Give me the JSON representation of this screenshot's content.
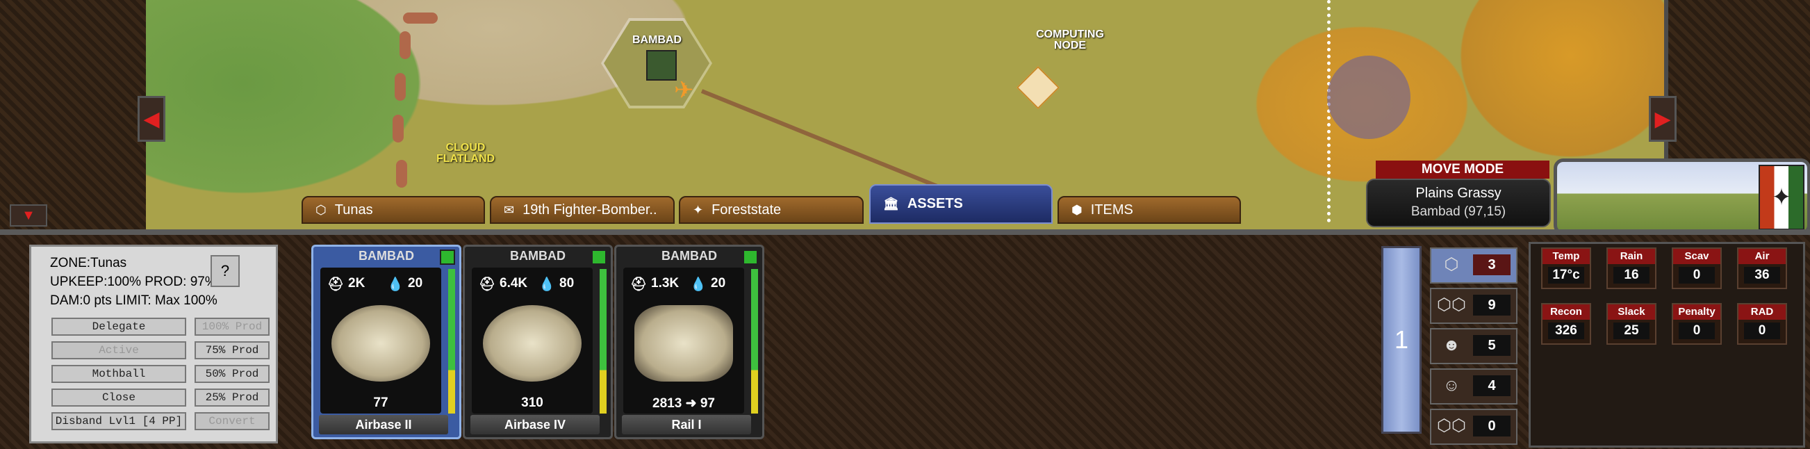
{
  "map": {
    "labels": {
      "bambad": "BAMBAD",
      "computing_node": "COMPUTING NODE",
      "cloud_flatland": "CLOUD FLATLAND"
    }
  },
  "tabs": [
    {
      "label": "Tunas",
      "icon": "hex-cluster-icon"
    },
    {
      "label": "19th Fighter-Bomber..",
      "icon": "envelope-icon"
    },
    {
      "label": "Foreststate",
      "icon": "eagle-icon"
    },
    {
      "label": "ASSETS",
      "icon": "building-icon"
    },
    {
      "label": "ITEMS",
      "icon": "box-icon"
    }
  ],
  "move_mode": {
    "title": "MOVE MODE",
    "terrain": "Plains Grassy",
    "location": "Bambad  (97,15)"
  },
  "zone": {
    "zone": "ZONE:Tunas",
    "upkeep_prod": "UPKEEP:100%  PROD: 97%",
    "dam_limit": "DAM:0 pts    LIMIT: Max 100%",
    "help": "?",
    "buttons_left": [
      "Delegate",
      "Active",
      "Mothball",
      "Close",
      "Disband Lvl1 [4 PP]"
    ],
    "buttons_right": [
      "100% Prod",
      "75% Prod",
      "50% Prod",
      "25% Prod",
      "Convert"
    ]
  },
  "cards": [
    {
      "header": "BAMBAD",
      "stat1": "2K",
      "stat2": "20",
      "value": "77",
      "name": "Airbase II"
    },
    {
      "header": "BAMBAD",
      "stat1": "6.4K",
      "stat2": "80",
      "value": "310",
      "name": "Airbase IV"
    },
    {
      "header": "BAMBAD",
      "stat1": "1.3K",
      "stat2": "20",
      "value_a": "2813",
      "value_b": "97",
      "name": "Rail I"
    }
  ],
  "level": "1",
  "counters": [
    "3",
    "9",
    "5",
    "4",
    "0"
  ],
  "weather": [
    {
      "label": "Temp",
      "value": "17°c"
    },
    {
      "label": "Rain",
      "value": "16"
    },
    {
      "label": "Scav",
      "value": "0"
    },
    {
      "label": "Air",
      "value": "36"
    },
    {
      "label": "Recon",
      "value": "326"
    },
    {
      "label": "Slack",
      "value": "25"
    },
    {
      "label": "Penalty",
      "value": "0"
    },
    {
      "label": "RAD",
      "value": "0"
    }
  ]
}
